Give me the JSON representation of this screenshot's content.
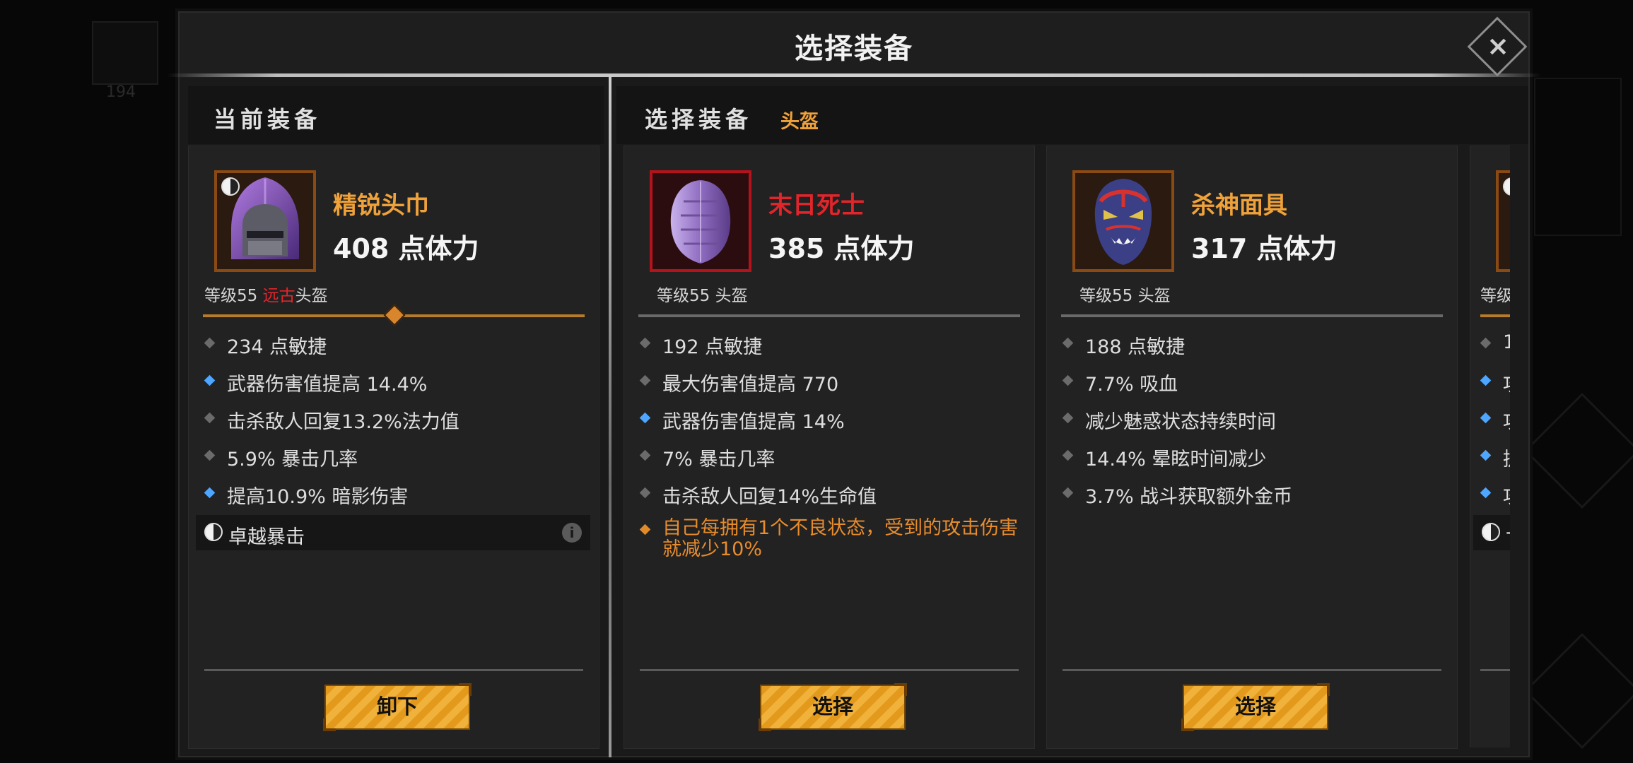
{
  "window": {
    "title": "选择装备",
    "close_label": "×"
  },
  "background": {
    "slot_count": "194"
  },
  "current": {
    "header": "当前装备",
    "item": {
      "name": "精锐头巾",
      "name_color": "#f0a23a",
      "stat": "408 点体力",
      "level_prefix": "等级55 ",
      "rarity": "远古",
      "rarity_color": "#e3252b",
      "slot": "头盔",
      "attributes": [
        {
          "text": "234 点敏捷",
          "bullet": "gray"
        },
        {
          "text": "武器伤害值提高 14.4%",
          "bullet": "blue"
        },
        {
          "text": "击杀敌人回复13.2%法力值",
          "bullet": "gray"
        },
        {
          "text": "5.9% 暴击几率",
          "bullet": "gray"
        },
        {
          "text": "提高10.9% 暗影伤害",
          "bullet": "blue"
        }
      ],
      "special": "卓越暴击",
      "info_icon": "i",
      "button": "卸下"
    }
  },
  "select": {
    "header": "选择装备",
    "category": "头盔",
    "items": [
      {
        "name": "末日死士",
        "name_color": "#e3252b",
        "stat": "385 点体力",
        "level": "等级55 头盔",
        "attributes": [
          {
            "text": "192 点敏捷",
            "bullet": "gray"
          },
          {
            "text": "最大伤害值提高 770",
            "bullet": "gray"
          },
          {
            "text": "武器伤害值提高 14%",
            "bullet": "blue"
          },
          {
            "text": "7% 暴击几率",
            "bullet": "gray"
          },
          {
            "text": "击杀敌人回复14%生命值",
            "bullet": "gray"
          },
          {
            "text": "自己每拥有1个不良状态，受到的攻击伤害就减少10%",
            "bullet": "orange"
          }
        ],
        "button": "选择"
      },
      {
        "name": "杀神面具",
        "name_color": "#f0a23a",
        "stat": "317 点体力",
        "level": "等级55 头盔",
        "attributes": [
          {
            "text": "188 点敏捷",
            "bullet": "gray"
          },
          {
            "text": "7.7% 吸血",
            "bullet": "gray"
          },
          {
            "text": "减少魅惑状态持续时间",
            "bullet": "gray"
          },
          {
            "text": "14.4% 晕眩时间减少",
            "bullet": "gray"
          },
          {
            "text": "3.7% 战斗获取额外金币",
            "bullet": "gray"
          }
        ],
        "button": "选择"
      },
      {
        "partial_level": "等级",
        "partial_attrs": [
          "1",
          "攻",
          "攻",
          "提",
          "攻"
        ],
        "partial_special": "-"
      }
    ]
  },
  "colors": {
    "accent_orange": "#f0a23a",
    "ancient_red": "#e3252b",
    "bullet_blue": "#4ea6ff",
    "button_orange": "#e39a1c"
  },
  "icons": [
    "close-icon",
    "yin-yang-icon",
    "info-icon",
    "hood-helmet-icon",
    "purple-helmet-icon",
    "demon-mask-icon"
  ]
}
